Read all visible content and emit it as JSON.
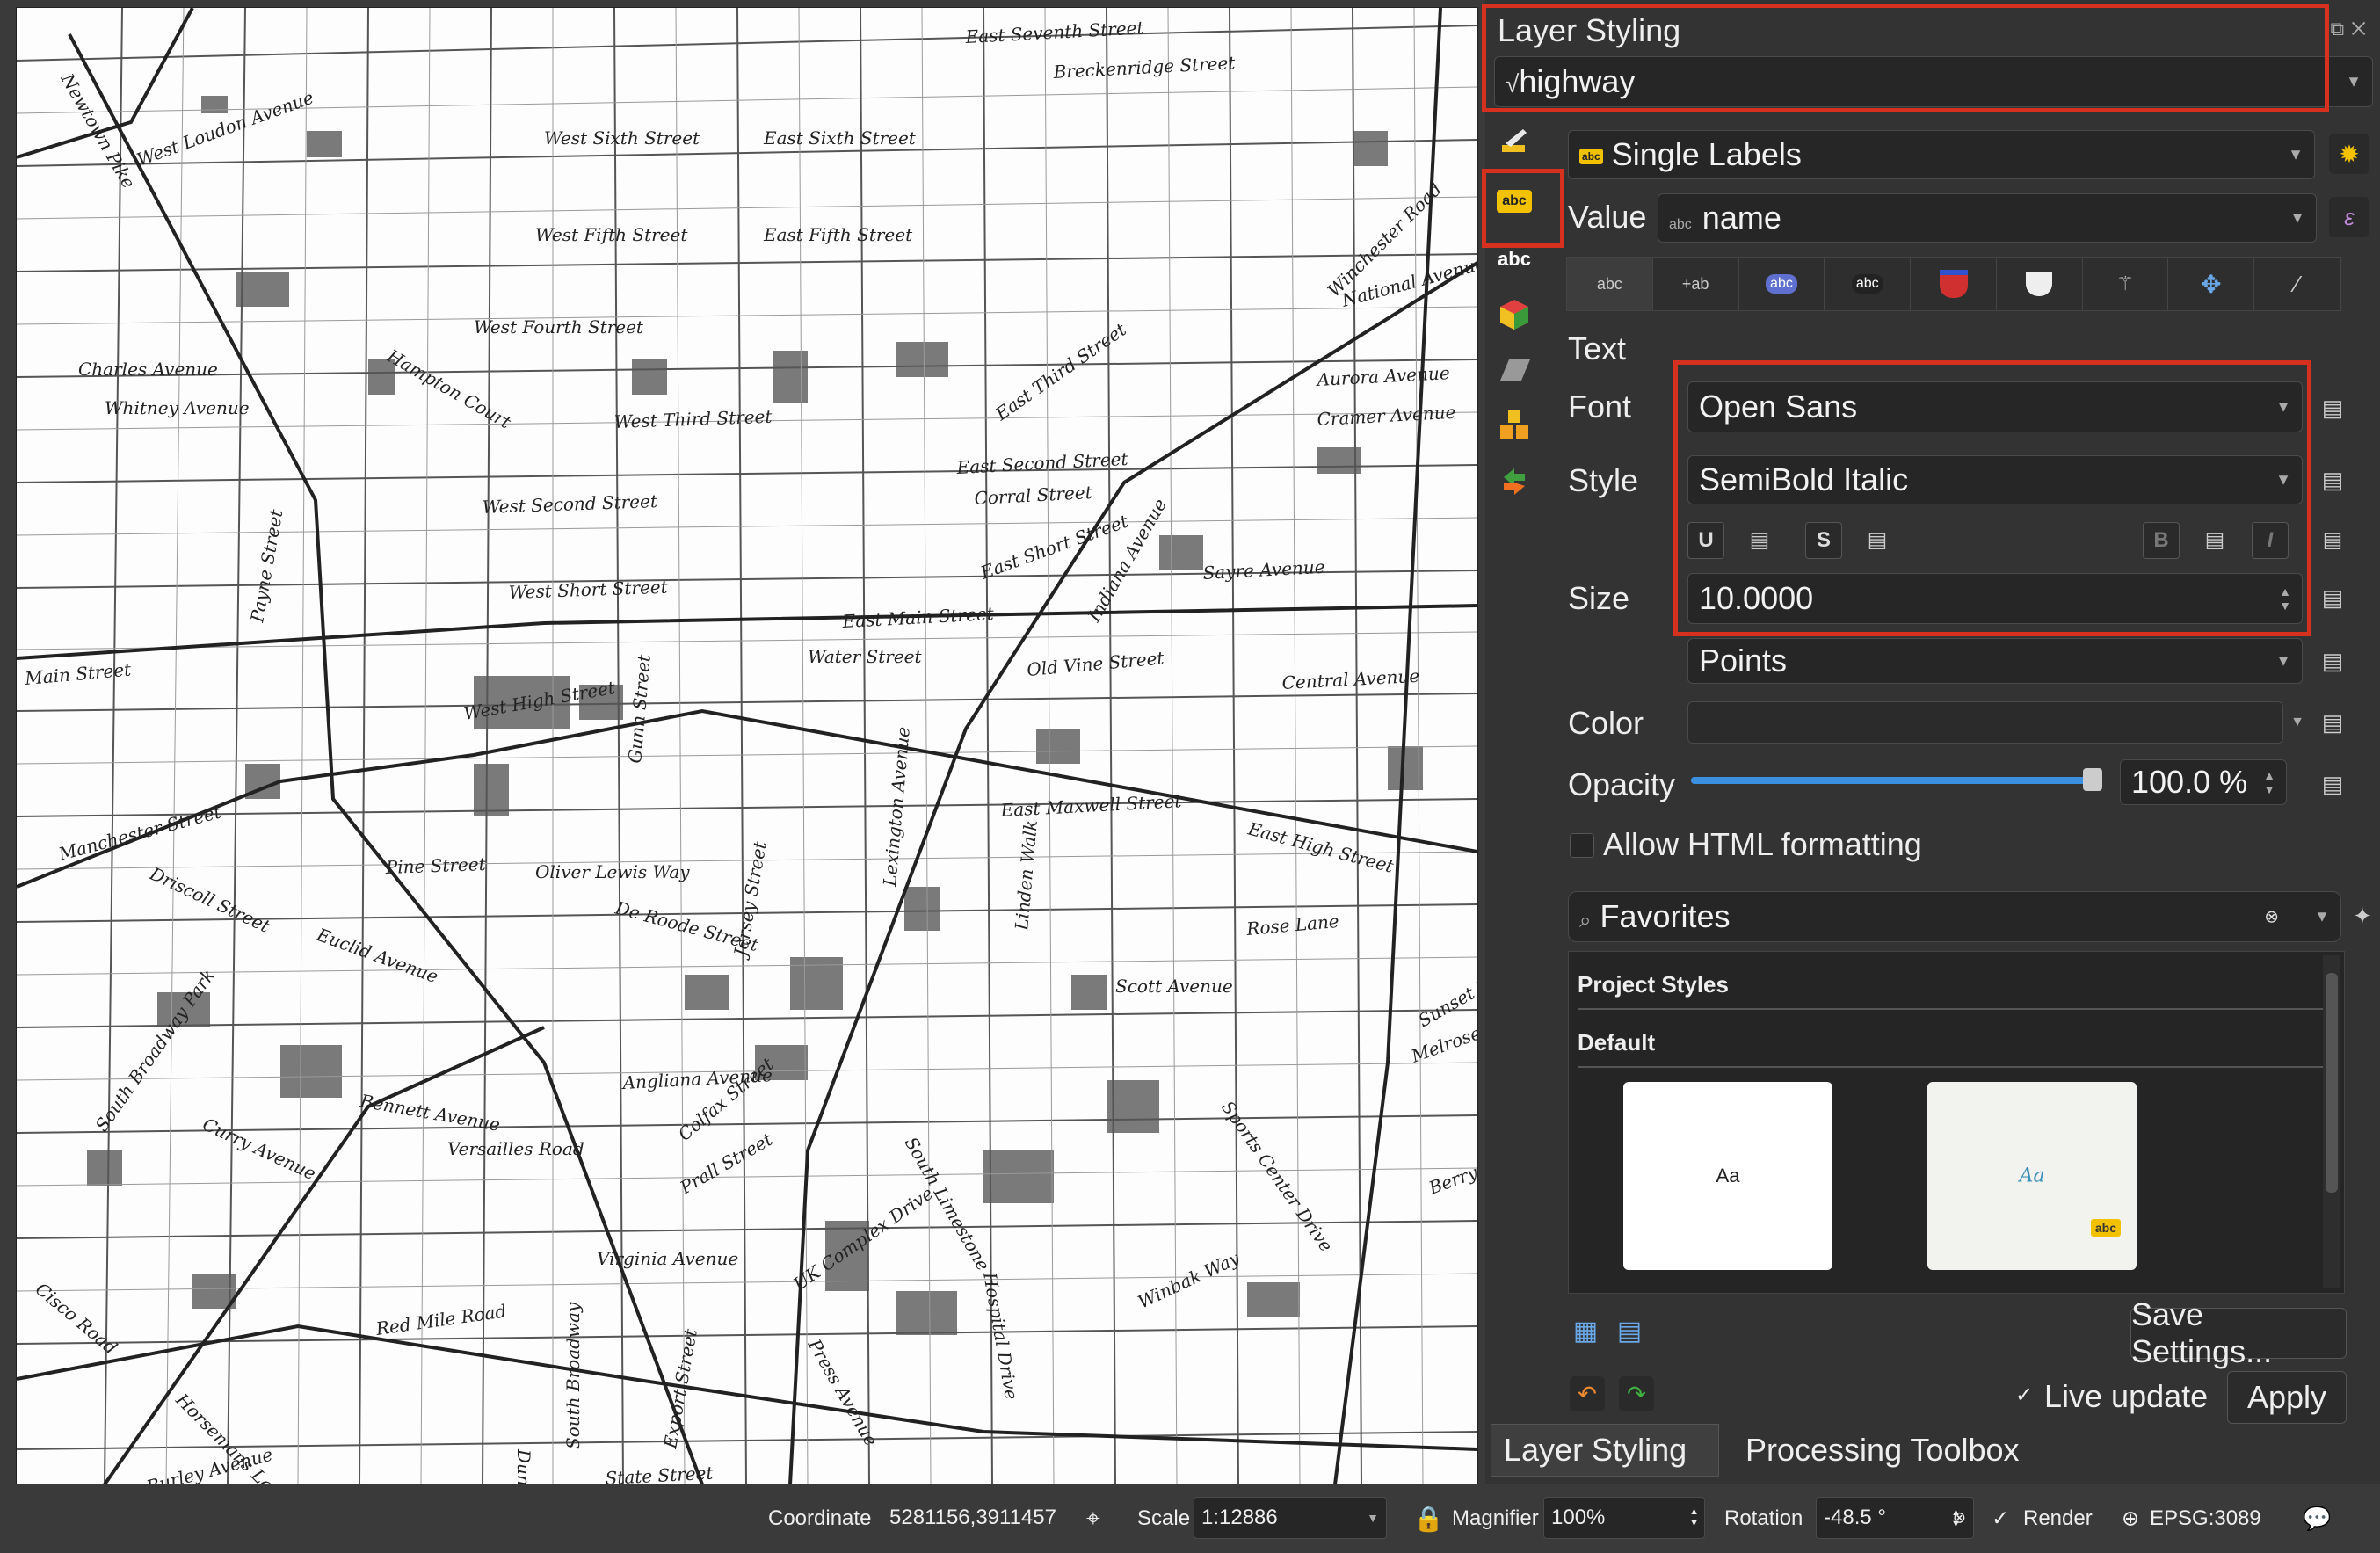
{
  "map": {
    "streets": [
      "East Seventh Street",
      "Breckenridge Street",
      "West Loudon Avenue",
      "Newtown Pike",
      "West Sixth Street",
      "East Sixth Street",
      "West Fifth Street",
      "East Fifth Street",
      "West Fourth Street",
      "Charles Avenue",
      "Whitney Avenue",
      "Hampton Court",
      "West Third Street",
      "East Third Street",
      "East Second Street",
      "West Second Street",
      "Corral Street",
      "East Short Street",
      "West Short Street",
      "Sayre Avenue",
      "Indiana Avenue",
      "East Main Street",
      "Water Street",
      "Old Vine Street",
      "Main Street",
      "West High Street",
      "East High Street",
      "East Maxwell Street",
      "Manchester Street",
      "Driscoll Street",
      "Pine Street",
      "Oliver Lewis Way",
      "De Roode Street",
      "Euclid Avenue",
      "Rose Lane",
      "Scott Avenue",
      "Angliana Avenue",
      "Bennett Avenue",
      "Curry Avenue",
      "Versailles Road",
      "South Broadway Park",
      "Virginia Avenue",
      "UK Complex Drive",
      "Winbak Way",
      "Red Mile Road",
      "Horsemans Lane",
      "Burley Avenue",
      "State Street",
      "National Avenue",
      "Aurora Avenue",
      "Cramer Avenue",
      "Central Avenue",
      "Winchester Road",
      "South Limestone",
      "Press Avenue",
      "Export Street",
      "Duncan Avenue",
      "South Broadway",
      "Colfax Street",
      "Prall Street",
      "Sports Center Drive",
      "Hospital Drive",
      "Berry Lane",
      "Sunset Drive",
      "Melrose Avenue",
      "Cisco Road",
      "Jersey Street",
      "Lexington Avenue",
      "Linden Walk",
      "Gunn Street",
      "Payne Street"
    ]
  },
  "panel": {
    "title": "Layer Styling",
    "layer_name": "highway",
    "label_mode": "Single Labels",
    "value_label": "Value",
    "value_field": "name",
    "section_title": "Text",
    "font_label": "Font",
    "font_value": "Open Sans",
    "style_label": "Style",
    "style_value": "SemiBold Italic",
    "underline_btn": "U",
    "strike_btn": "S",
    "bold_btn": "B",
    "italic_btn": "I",
    "size_label": "Size",
    "size_value": "10.0000",
    "size_unit": "Points",
    "color_label": "Color",
    "opacity_label": "Opacity",
    "opacity_value": "100.0 %",
    "opacity_fraction": 1.0,
    "html_label": "Allow HTML formatting",
    "search_value": "Favorites",
    "project_styles": "Project Styles",
    "default_group": "Default",
    "thumb1_text": "Aa",
    "thumb2_text": "Aa",
    "thumb2_badge": "abc",
    "save_settings": "Save Settings...",
    "live_update": "Live update",
    "apply": "Apply",
    "tab_layer_styling": "Layer Styling",
    "tab_processing": "Processing Toolbox",
    "side_icon_abc": "abc",
    "label_tab_abc": "abc"
  },
  "status": {
    "coordinate_label": "Coordinate",
    "coordinate_value": "5281156,3911457",
    "scale_label": "Scale",
    "scale_value": "1:12886",
    "magnifier_label": "Magnifier",
    "magnifier_value": "100%",
    "rotation_label": "Rotation",
    "rotation_value": "-48.5 °",
    "render_label": "Render",
    "crs": "EPSG:3089"
  },
  "colors": {
    "highlight": "#d6301e",
    "slider": "#3b8fe0",
    "label_icon": "#f2c200"
  }
}
